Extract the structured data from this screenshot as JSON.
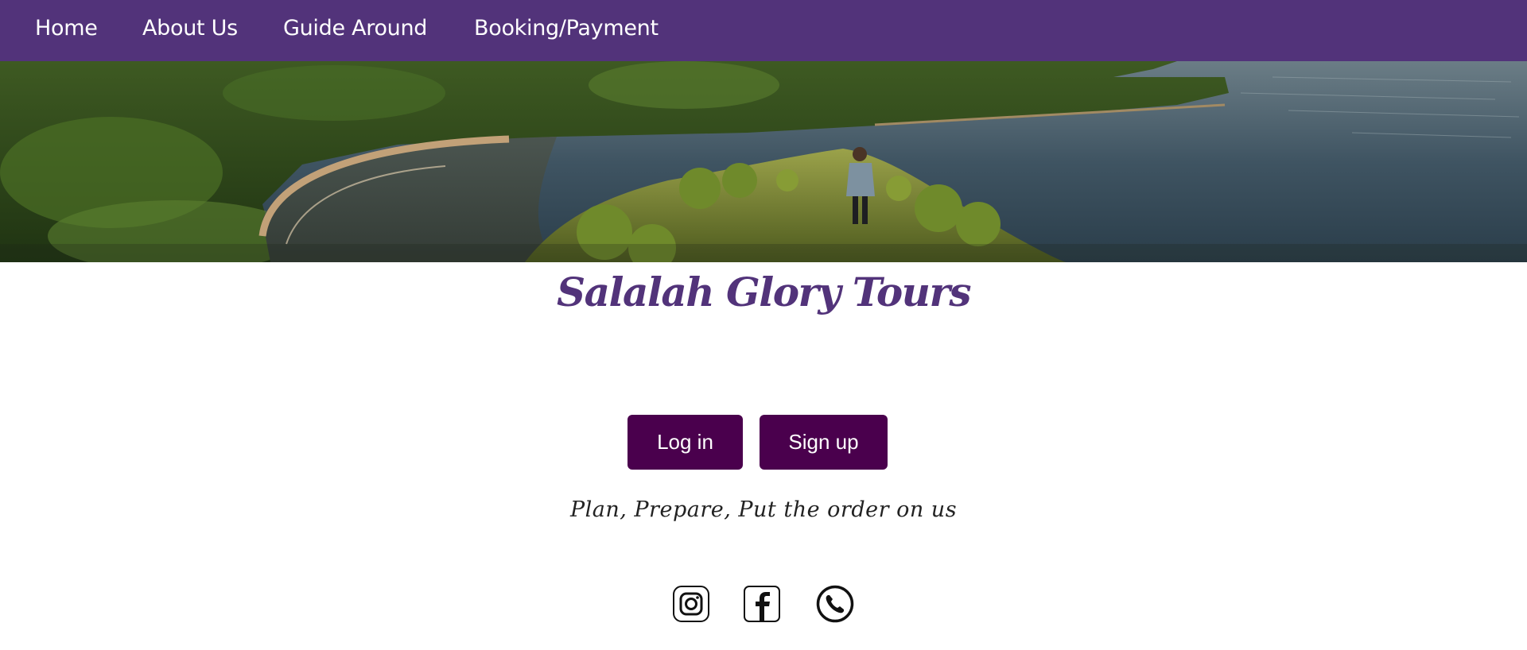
{
  "nav": {
    "items": [
      {
        "label": "Home"
      },
      {
        "label": "About Us"
      },
      {
        "label": "Guide Around"
      },
      {
        "label": "Booking/Payment"
      }
    ]
  },
  "brand": {
    "title": "Salalah Glory Tours",
    "tagline": "Plan, Prepare, Put the order on us"
  },
  "auth": {
    "login_label": "Log in",
    "signup_label": "Sign up"
  },
  "social": [
    "instagram-icon",
    "facebook-icon",
    "phone-icon"
  ],
  "colors": {
    "nav_bg": "#52337a",
    "brand": "#52337a",
    "button_bg": "#4a004d",
    "button_text": "#ffffff"
  }
}
